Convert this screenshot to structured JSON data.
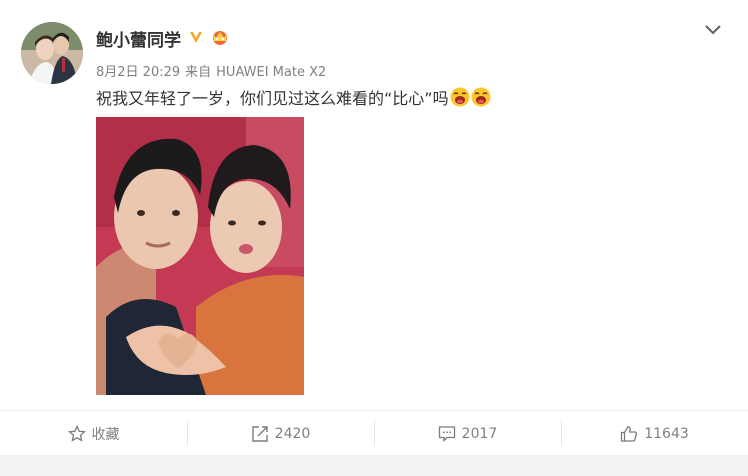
{
  "post": {
    "username": "鲍小蕾同学",
    "date": "8月2日 20:29",
    "source_prefix": "来自",
    "device": "HUAWEI Mate X2",
    "text": "祝我又年轻了一岁，你们见过这么难看的“比心”吗"
  },
  "actions": {
    "favorite_label": "收藏",
    "repost_count": "2420",
    "comment_count": "2017",
    "like_count": "11643"
  },
  "colors": {
    "verified_badge": "#f5a623",
    "meta_gray": "#808080",
    "photo_bg": "#c43a55"
  },
  "icons": [
    "chevron-down-icon",
    "verified-icon",
    "member-crown-icon",
    "star-icon",
    "repost-icon",
    "comment-icon",
    "like-icon",
    "laugh-emoji-icon"
  ]
}
